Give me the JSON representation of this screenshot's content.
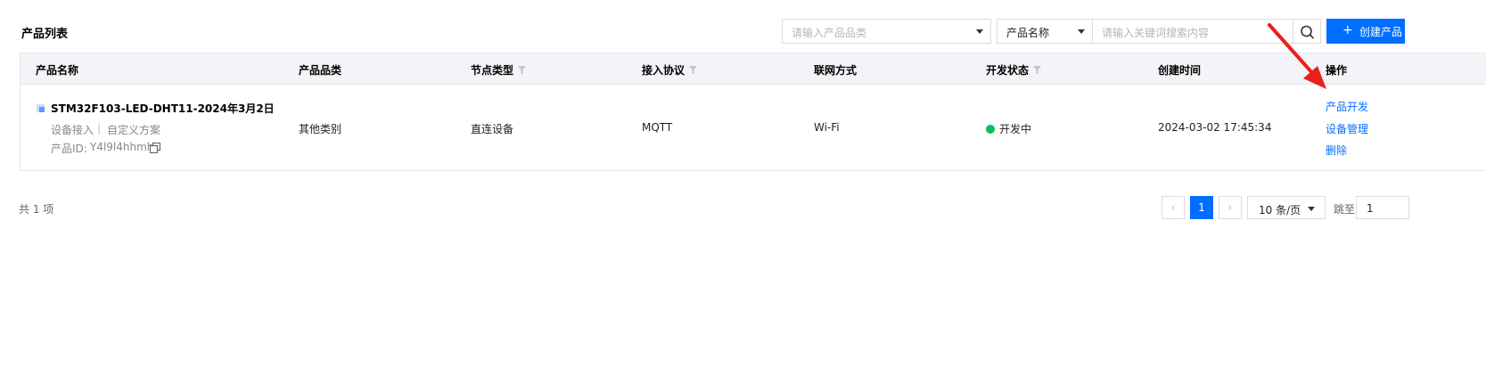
{
  "page": {
    "title": "产品列表"
  },
  "toolbar": {
    "category_placeholder": "请输入产品品类",
    "field_select_value": "产品名称",
    "search_placeholder": "请输入关键词搜索内容",
    "search_icon": "search-icon",
    "create_icon": "plus-icon",
    "create_label": "创建产品"
  },
  "table": {
    "columns": [
      {
        "label": "产品名称",
        "filterable": false
      },
      {
        "label": "产品品类",
        "filterable": false
      },
      {
        "label": "节点类型",
        "filterable": true
      },
      {
        "label": "接入协议",
        "filterable": true
      },
      {
        "label": "联网方式",
        "filterable": false
      },
      {
        "label": "开发状态",
        "filterable": true
      },
      {
        "label": "创建时间",
        "filterable": false
      },
      {
        "label": "操作",
        "filterable": false
      }
    ],
    "rows": [
      {
        "name": "STM32F103-LED-DHT11-2024年3月2日",
        "access": "设备接入",
        "separator": "|",
        "scheme": "自定义方案",
        "id_label": "产品ID:",
        "id_value": "Y4l9l4hhmh",
        "copy_icon": "copy-icon",
        "category": "其他类别",
        "node_type": "直连设备",
        "protocol": "MQTT",
        "network": "Wi-Fi",
        "status": "开发中",
        "status_color": "#0abf5b",
        "created": "2024-03-02 17:45:34",
        "actions": [
          "产品开发",
          "设备管理",
          "删除"
        ]
      }
    ]
  },
  "footer": {
    "total": "共 1 项",
    "prev_icon": "chevron-left-icon",
    "next_icon": "chevron-right-icon",
    "current_page": "1",
    "page_size": "10 条/页",
    "jump_label": "跳至",
    "jump_value": "1"
  },
  "colors": {
    "accent": "#006eff",
    "annotation": "#e8211b"
  }
}
